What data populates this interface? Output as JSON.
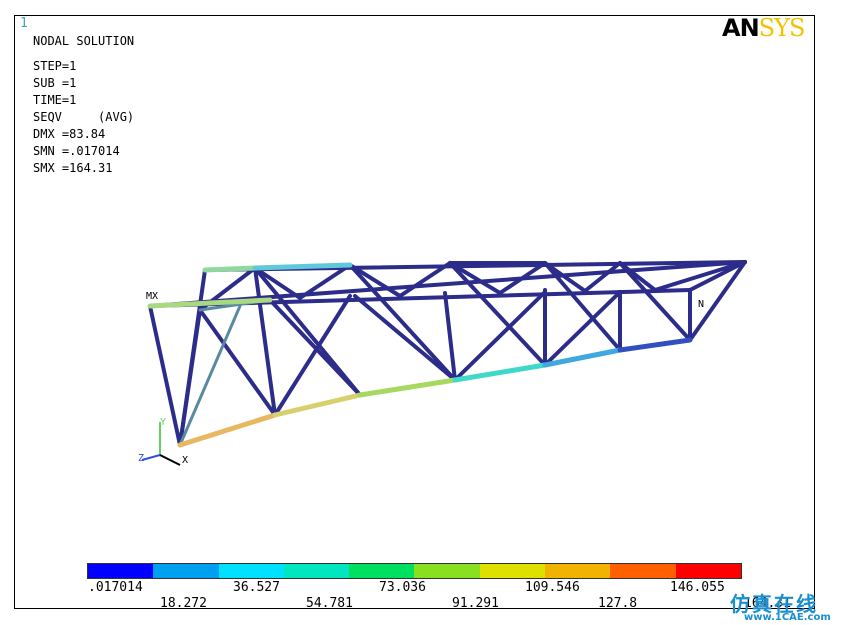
{
  "window_number": "1",
  "solution_title": "NODAL SOLUTION",
  "info": {
    "step": "STEP=1",
    "sub": "SUB =1",
    "time": "TIME=1",
    "seqv": "SEQV     (AVG)",
    "dmx": "DMX =83.84",
    "smn": "SMN =.017014",
    "smx": "SMX =164.31"
  },
  "logo": {
    "an": "AN",
    "sys": "SYS"
  },
  "markers": {
    "mx": "MX",
    "mn": "N"
  },
  "triad": {
    "y": "Y",
    "z": "Z",
    "x": "X"
  },
  "legend": {
    "colors": [
      "#0000ff",
      "#00a0f0",
      "#00e0ff",
      "#00e6c0",
      "#00e060",
      "#88e020",
      "#e0e000",
      "#f0b400",
      "#ff6000",
      "#ff0000"
    ],
    "labels_top": [
      ".017014",
      "36.527",
      "73.036",
      "109.546",
      "146.055"
    ],
    "labels_bottom": [
      "18.272",
      "54.781",
      "91.291",
      "127.8",
      "164.31"
    ]
  },
  "watermark": {
    "cn": "仿真在线",
    "url": "www.1CAE.com"
  }
}
